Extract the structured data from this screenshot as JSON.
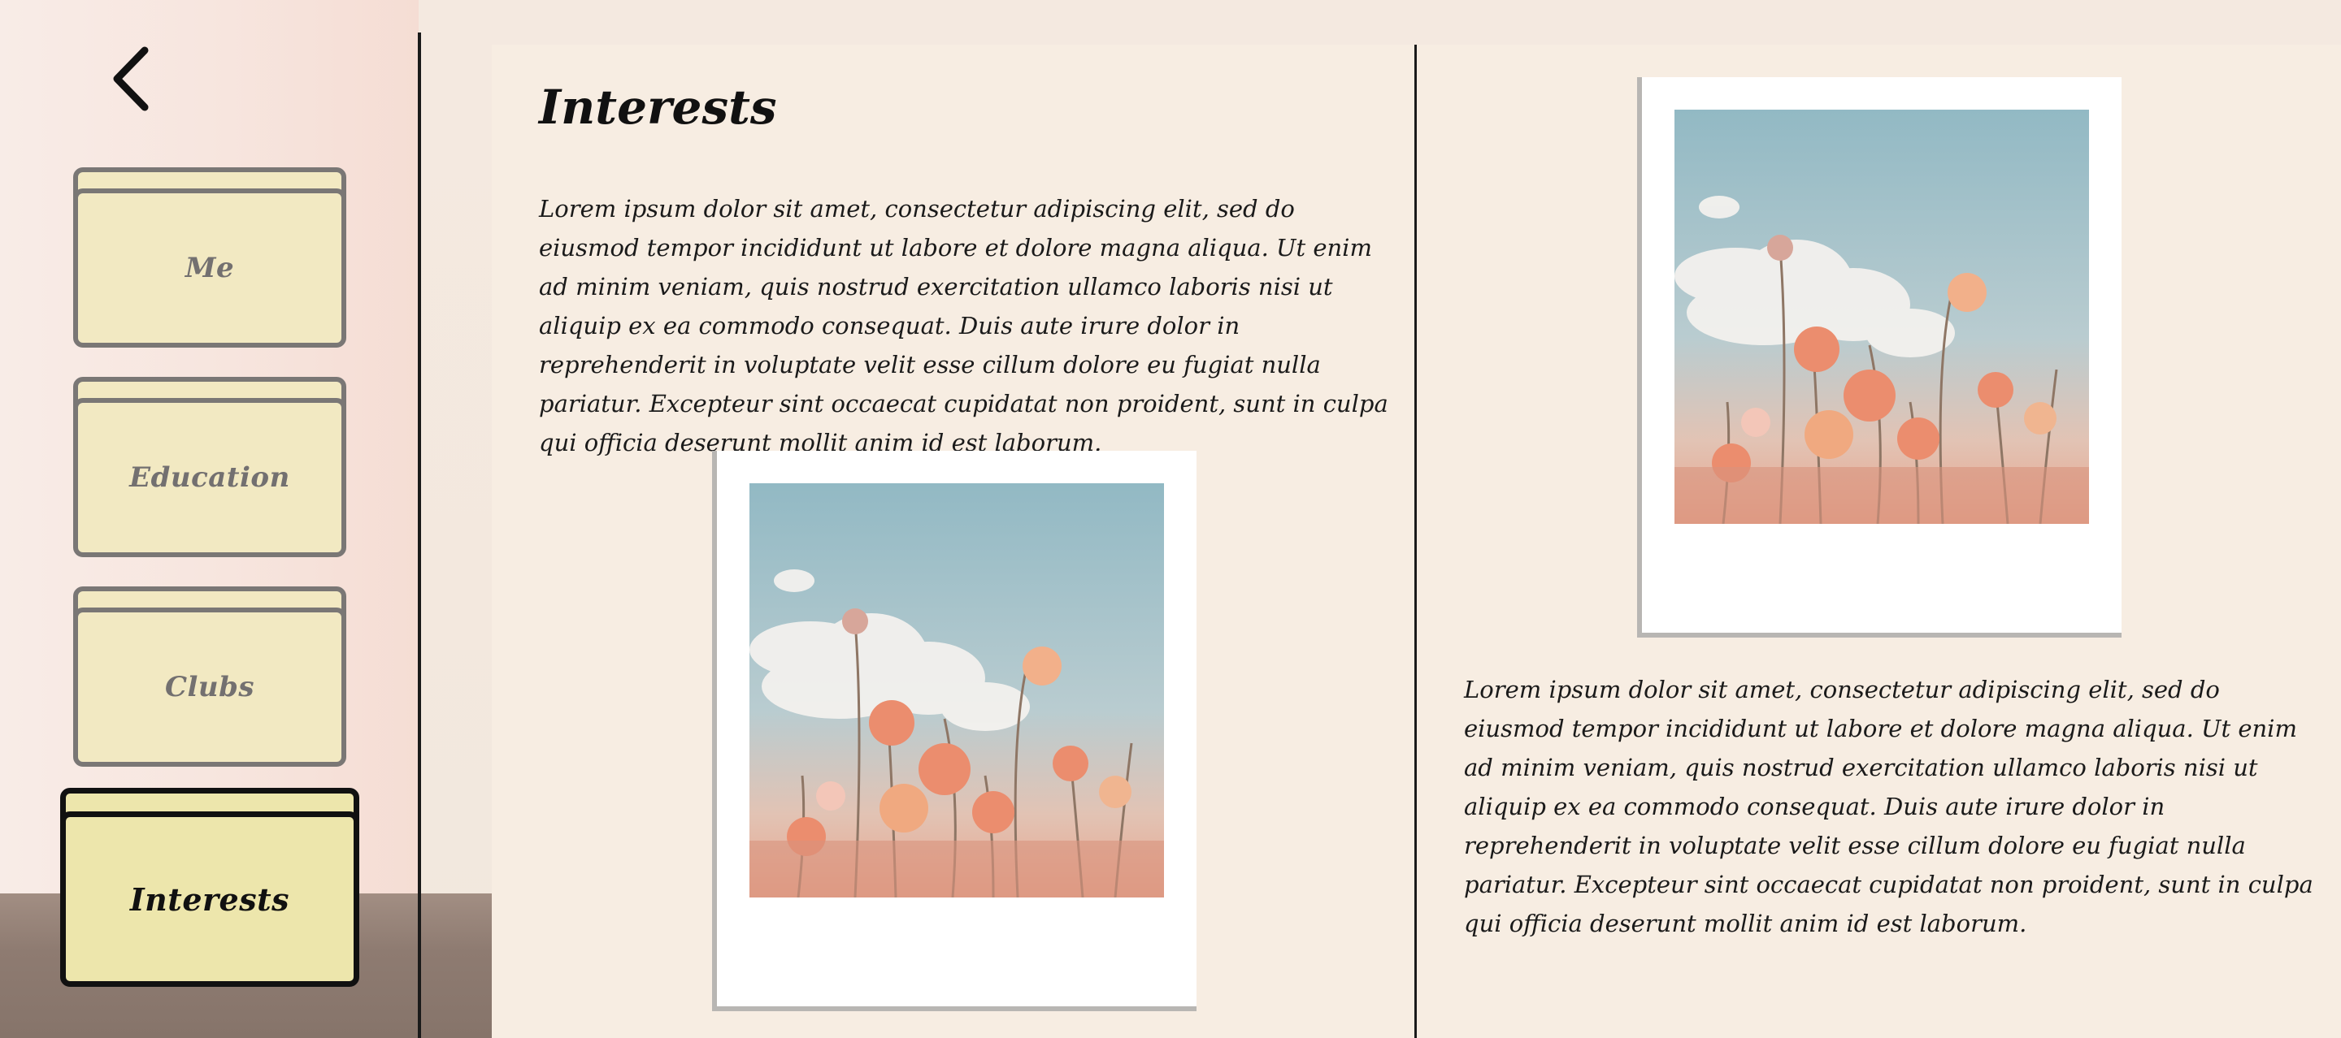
{
  "nav": {
    "back_label": "Back",
    "items": [
      {
        "label": "Me"
      },
      {
        "label": "Education"
      },
      {
        "label": "Clubs"
      },
      {
        "label": "Interests"
      }
    ],
    "active": "Interests"
  },
  "content": {
    "title": "Interests",
    "paragraph_1": "Lorem ipsum dolor sit amet, consectetur adipiscing elit, sed do eiusmod tempor incididunt ut labore et dolore magna aliqua. Ut enim ad minim veniam, quis nostrud exercitation ullamco laboris nisi ut aliquip ex ea commodo consequat. Duis aute irure dolor in reprehenderit in voluptate velit esse cillum dolore eu fugiat nulla pariatur. Excepteur sint occaecat cupidatat non proident, sunt in culpa qui officia deserunt mollit anim id est laborum.",
    "paragraph_2": "Lorem ipsum dolor sit amet, consectetur adipiscing elit, sed do eiusmod tempor incididunt ut labore et dolore magna aliqua. Ut enim ad minim veniam, quis nostrud exercitation ullamco laboris nisi ut aliquip ex ea commodo consequat. Duis aute irure dolor in reprehenderit in voluptate velit esse cillum dolore eu fugiat nulla pariatur. Excepteur sint occaecat cupidatat non proident, sunt in culpa qui officia deserunt mollit anim id est laborum."
  },
  "icons": {
    "back": "chevron-left-icon"
  },
  "colors": {
    "card_fill": "#f2e9c2",
    "card_active_fill": "#ede6ac",
    "card_border": "#7a7775",
    "text": "#111111",
    "sky": "#98bcc6",
    "flower": "#e99474"
  }
}
